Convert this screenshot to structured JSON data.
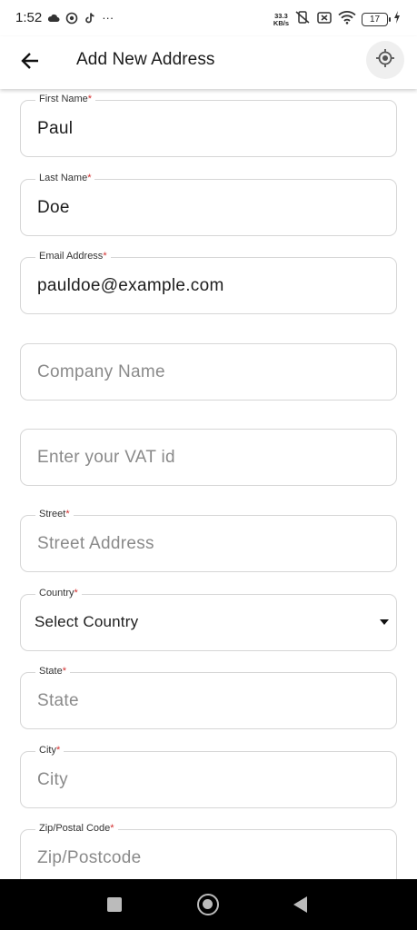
{
  "status_bar": {
    "time": "1:52",
    "more": "···",
    "net_speed_value": "33.3",
    "net_speed_unit": "KB/s",
    "battery": "17"
  },
  "header": {
    "title": "Add New Address",
    "back_icon": "arrow-left-icon",
    "location_icon": "gps-target-icon"
  },
  "form": {
    "first_name": {
      "label": "First Name",
      "required": "*",
      "value": "Paul"
    },
    "last_name": {
      "label": "Last Name",
      "required": "*",
      "value": "Doe"
    },
    "email": {
      "label": "Email Address",
      "required": "*",
      "value": "pauldoe@example.com"
    },
    "company": {
      "placeholder": "Company Name"
    },
    "vat": {
      "placeholder": "Enter your VAT id"
    },
    "street": {
      "label": "Street",
      "required": "*",
      "placeholder": "Street Address"
    },
    "country": {
      "label": "Country",
      "required": "*",
      "value": "Select Country"
    },
    "state": {
      "label": "State",
      "required": "*",
      "placeholder": "State"
    },
    "city": {
      "label": "City",
      "required": "*",
      "placeholder": "City"
    },
    "zip": {
      "label": "Zip/Postal Code",
      "required": "*",
      "placeholder": "Zip/Postcode"
    }
  },
  "colors": {
    "required": "#d32f2f",
    "border": "#d6d6d6",
    "nav_bar": "#000000"
  }
}
